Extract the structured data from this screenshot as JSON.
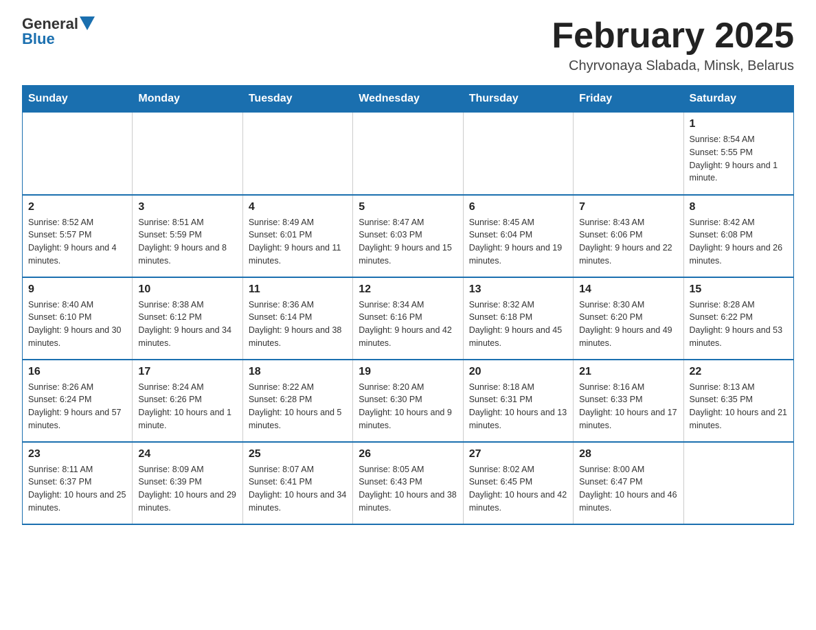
{
  "header": {
    "logo_general": "General",
    "logo_blue": "Blue",
    "month_title": "February 2025",
    "location": "Chyrvonaya Slabada, Minsk, Belarus"
  },
  "days_of_week": [
    "Sunday",
    "Monday",
    "Tuesday",
    "Wednesday",
    "Thursday",
    "Friday",
    "Saturday"
  ],
  "weeks": [
    {
      "days": [
        {
          "num": "",
          "info": ""
        },
        {
          "num": "",
          "info": ""
        },
        {
          "num": "",
          "info": ""
        },
        {
          "num": "",
          "info": ""
        },
        {
          "num": "",
          "info": ""
        },
        {
          "num": "",
          "info": ""
        },
        {
          "num": "1",
          "info": "Sunrise: 8:54 AM\nSunset: 5:55 PM\nDaylight: 9 hours and 1 minute."
        }
      ]
    },
    {
      "days": [
        {
          "num": "2",
          "info": "Sunrise: 8:52 AM\nSunset: 5:57 PM\nDaylight: 9 hours and 4 minutes."
        },
        {
          "num": "3",
          "info": "Sunrise: 8:51 AM\nSunset: 5:59 PM\nDaylight: 9 hours and 8 minutes."
        },
        {
          "num": "4",
          "info": "Sunrise: 8:49 AM\nSunset: 6:01 PM\nDaylight: 9 hours and 11 minutes."
        },
        {
          "num": "5",
          "info": "Sunrise: 8:47 AM\nSunset: 6:03 PM\nDaylight: 9 hours and 15 minutes."
        },
        {
          "num": "6",
          "info": "Sunrise: 8:45 AM\nSunset: 6:04 PM\nDaylight: 9 hours and 19 minutes."
        },
        {
          "num": "7",
          "info": "Sunrise: 8:43 AM\nSunset: 6:06 PM\nDaylight: 9 hours and 22 minutes."
        },
        {
          "num": "8",
          "info": "Sunrise: 8:42 AM\nSunset: 6:08 PM\nDaylight: 9 hours and 26 minutes."
        }
      ]
    },
    {
      "days": [
        {
          "num": "9",
          "info": "Sunrise: 8:40 AM\nSunset: 6:10 PM\nDaylight: 9 hours and 30 minutes."
        },
        {
          "num": "10",
          "info": "Sunrise: 8:38 AM\nSunset: 6:12 PM\nDaylight: 9 hours and 34 minutes."
        },
        {
          "num": "11",
          "info": "Sunrise: 8:36 AM\nSunset: 6:14 PM\nDaylight: 9 hours and 38 minutes."
        },
        {
          "num": "12",
          "info": "Sunrise: 8:34 AM\nSunset: 6:16 PM\nDaylight: 9 hours and 42 minutes."
        },
        {
          "num": "13",
          "info": "Sunrise: 8:32 AM\nSunset: 6:18 PM\nDaylight: 9 hours and 45 minutes."
        },
        {
          "num": "14",
          "info": "Sunrise: 8:30 AM\nSunset: 6:20 PM\nDaylight: 9 hours and 49 minutes."
        },
        {
          "num": "15",
          "info": "Sunrise: 8:28 AM\nSunset: 6:22 PM\nDaylight: 9 hours and 53 minutes."
        }
      ]
    },
    {
      "days": [
        {
          "num": "16",
          "info": "Sunrise: 8:26 AM\nSunset: 6:24 PM\nDaylight: 9 hours and 57 minutes."
        },
        {
          "num": "17",
          "info": "Sunrise: 8:24 AM\nSunset: 6:26 PM\nDaylight: 10 hours and 1 minute."
        },
        {
          "num": "18",
          "info": "Sunrise: 8:22 AM\nSunset: 6:28 PM\nDaylight: 10 hours and 5 minutes."
        },
        {
          "num": "19",
          "info": "Sunrise: 8:20 AM\nSunset: 6:30 PM\nDaylight: 10 hours and 9 minutes."
        },
        {
          "num": "20",
          "info": "Sunrise: 8:18 AM\nSunset: 6:31 PM\nDaylight: 10 hours and 13 minutes."
        },
        {
          "num": "21",
          "info": "Sunrise: 8:16 AM\nSunset: 6:33 PM\nDaylight: 10 hours and 17 minutes."
        },
        {
          "num": "22",
          "info": "Sunrise: 8:13 AM\nSunset: 6:35 PM\nDaylight: 10 hours and 21 minutes."
        }
      ]
    },
    {
      "days": [
        {
          "num": "23",
          "info": "Sunrise: 8:11 AM\nSunset: 6:37 PM\nDaylight: 10 hours and 25 minutes."
        },
        {
          "num": "24",
          "info": "Sunrise: 8:09 AM\nSunset: 6:39 PM\nDaylight: 10 hours and 29 minutes."
        },
        {
          "num": "25",
          "info": "Sunrise: 8:07 AM\nSunset: 6:41 PM\nDaylight: 10 hours and 34 minutes."
        },
        {
          "num": "26",
          "info": "Sunrise: 8:05 AM\nSunset: 6:43 PM\nDaylight: 10 hours and 38 minutes."
        },
        {
          "num": "27",
          "info": "Sunrise: 8:02 AM\nSunset: 6:45 PM\nDaylight: 10 hours and 42 minutes."
        },
        {
          "num": "28",
          "info": "Sunrise: 8:00 AM\nSunset: 6:47 PM\nDaylight: 10 hours and 46 minutes."
        },
        {
          "num": "",
          "info": ""
        }
      ]
    }
  ]
}
